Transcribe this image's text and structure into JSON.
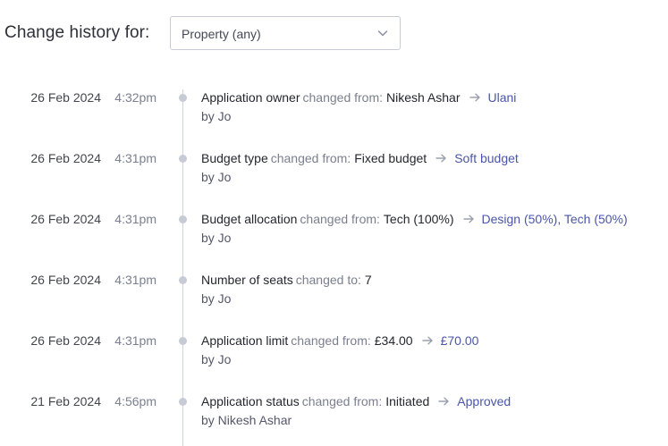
{
  "filter": {
    "label": "Change history for:",
    "selected": "Property (any)",
    "chevron_icon": "chevron-down-icon"
  },
  "entries": [
    {
      "date": "26 Feb 2024",
      "time": "4:32pm",
      "property": "Application owner",
      "verb": "changed from:",
      "old_value": "Nikesh Ashar",
      "new_value": "Ulani",
      "by": "by Jo"
    },
    {
      "date": "26 Feb 2024",
      "time": "4:31pm",
      "property": "Budget type",
      "verb": "changed from:",
      "old_value": "Fixed budget",
      "new_value": "Soft budget",
      "by": "by Jo"
    },
    {
      "date": "26 Feb 2024",
      "time": "4:31pm",
      "property": "Budget allocation",
      "verb": "changed from:",
      "old_value": "Tech (100%)",
      "new_value": "Design (50%), Tech (50%)",
      "by": "by Jo"
    },
    {
      "date": "26 Feb 2024",
      "time": "4:31pm",
      "property": "Number of seats",
      "verb": "changed to:",
      "old_value": "7",
      "new_value": null,
      "by": "by Jo"
    },
    {
      "date": "26 Feb 2024",
      "time": "4:31pm",
      "property": "Application limit",
      "verb": "changed from:",
      "old_value": "£34.00",
      "new_value": "£70.00",
      "by": "by Jo"
    },
    {
      "date": "21 Feb 2024",
      "time": "4:56pm",
      "property": "Application status",
      "verb": "changed from:",
      "old_value": "Initiated",
      "new_value": "Approved",
      "by": "by Nikesh Ashar"
    }
  ],
  "colors": {
    "accent_new_value": "#4a56a8",
    "timeline": "#cfd3dc"
  }
}
